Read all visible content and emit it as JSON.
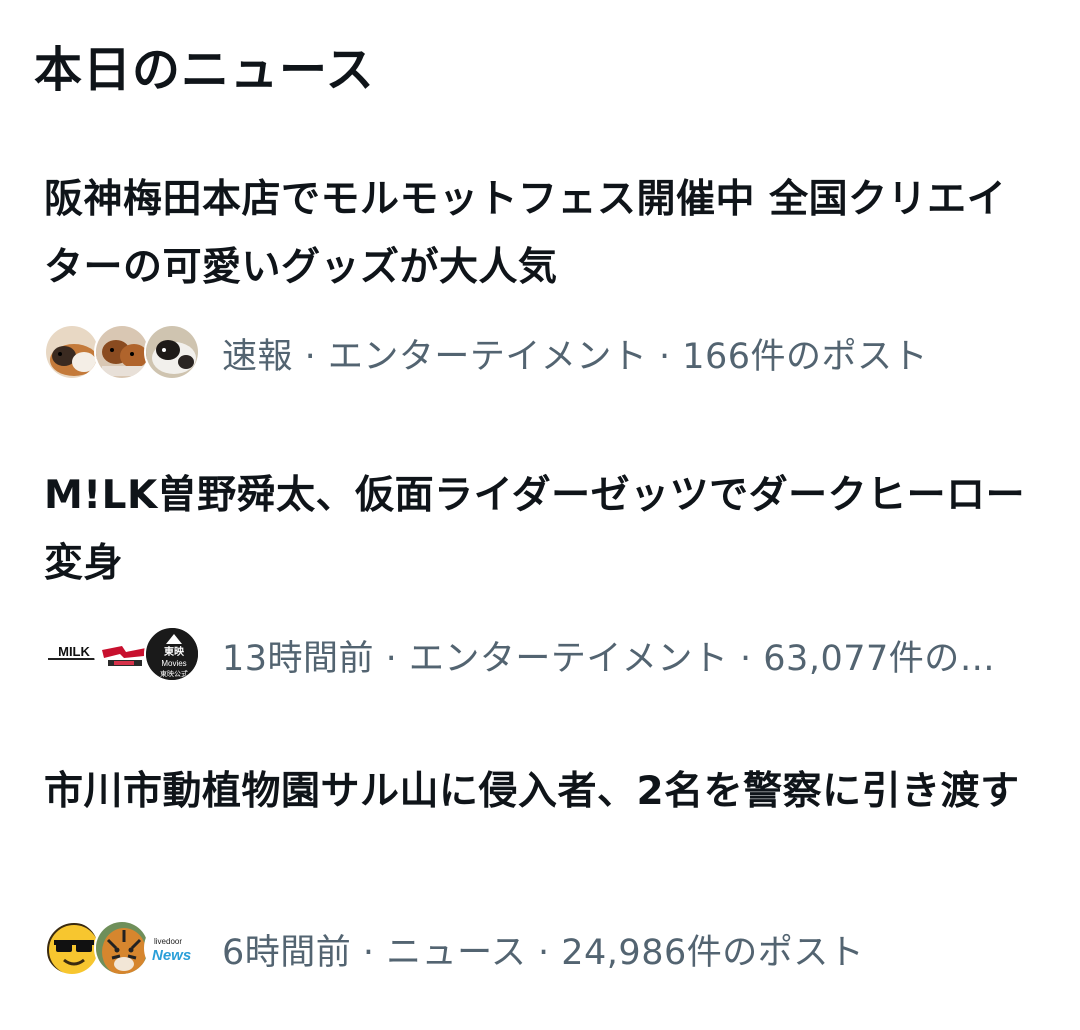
{
  "section": {
    "title": "本日のニュース"
  },
  "news": [
    {
      "headline": "阪神梅田本店でモルモットフェス開催中 全国クリエイターの可愛いグッズが大人気",
      "meta": "速報 · エンターテイメント · 166件のポスト",
      "avatars": [
        "guinea-pig-photo",
        "guinea-pig-photo",
        "guinea-pig-photo"
      ]
    },
    {
      "headline": "M!LK曽野舜太、仮面ライダーゼッツでダークヒーロー変身",
      "meta": "13時間前 · エンターテイメント · 63,077件のポ...",
      "avatars": [
        "milk-logo",
        "kamen-rider-logo",
        "toei-movies-logo"
      ],
      "avatar_text": {
        "milk": "MILK",
        "toei_top": "東映",
        "toei_mid": "Movies",
        "toei_bottom": "東映公式"
      }
    },
    {
      "headline": "市川市動植物園サル山に侵入者、2名を警察に引き渡す",
      "meta": "6時間前 · ニュース · 24,986件のポスト",
      "avatars": [
        "sunglasses-emoji",
        "tiger-photo",
        "livedoor-news-logo"
      ],
      "avatar_text": {
        "livedoor_top": "livedoor",
        "livedoor_main": "News"
      }
    }
  ],
  "colors": {
    "text": "#0f1419",
    "meta": "#536471",
    "background": "#ffffff"
  }
}
